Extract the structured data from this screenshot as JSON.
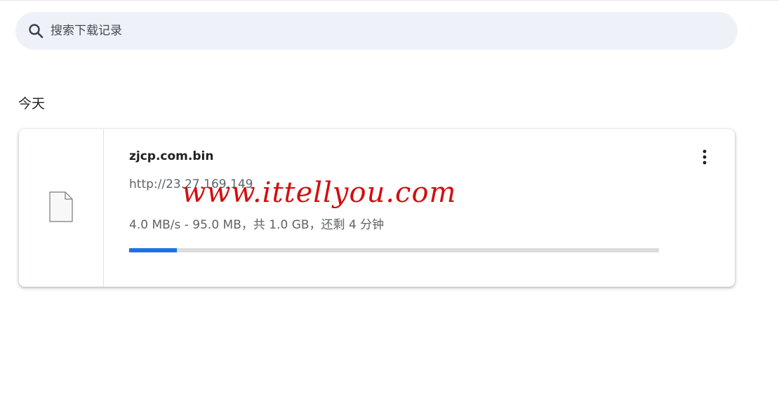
{
  "search": {
    "placeholder": "搜索下载记录",
    "icon": "search-icon"
  },
  "section": {
    "heading": "今天"
  },
  "download": {
    "file_icon": "file-icon",
    "file_name": "zjcp.com.bin",
    "url": "http://23.27.169.149",
    "status": "4.0 MB/s - 95.0 MB，共 1.0 GB，还剩 4 分钟",
    "progress_percent": 9,
    "progress_color": "#1a73e8",
    "more_icon": "more-vert-icon"
  },
  "watermark": {
    "text": "www.ittellyou.com",
    "color": "#d10f0f"
  }
}
